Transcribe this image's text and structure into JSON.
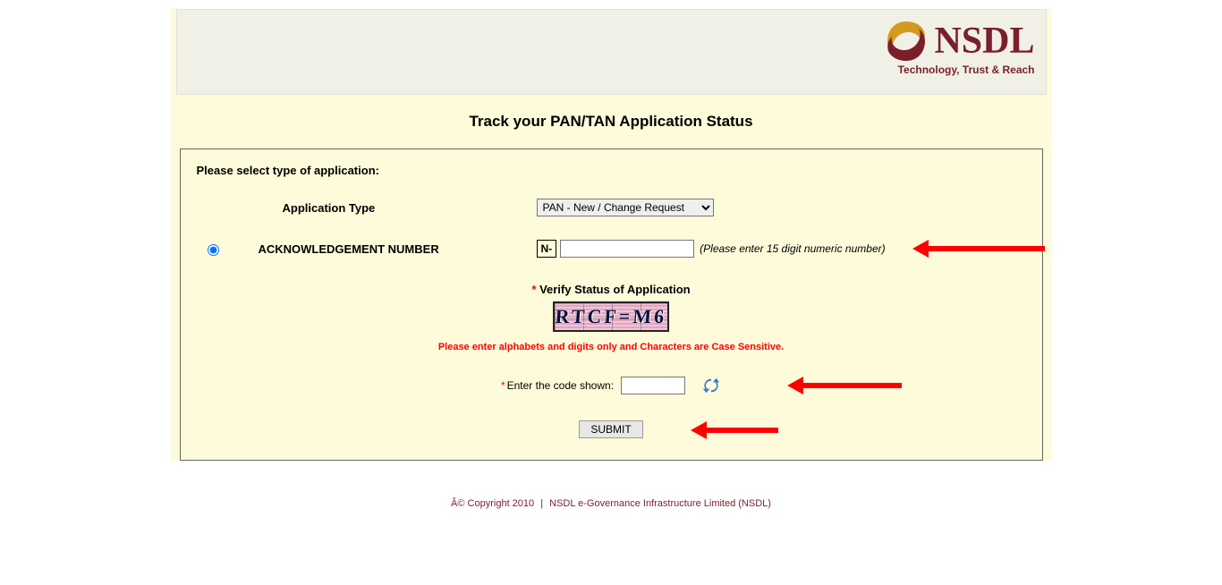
{
  "brand": {
    "name": "NSDL",
    "tagline": "Technology, Trust & Reach"
  },
  "page": {
    "title": "Track your PAN/TAN Application Status"
  },
  "form": {
    "instruction": "Please select type of application:",
    "appTypeLabel": "Application Type",
    "appTypeSelected": "PAN - New / Change Request",
    "ackLabel": "ACKNOWLEDGEMENT NUMBER",
    "ackPrefix": "N-",
    "ackValue": "",
    "ackHint": "(Please enter 15 digit numeric number)"
  },
  "captcha": {
    "title": "Verify Status of Application",
    "imageText": "RTCF=M6",
    "warning": "Please enter alphabets and digits only and Characters are Case Sensitive.",
    "codeLabel": "Enter the code shown:",
    "codeValue": ""
  },
  "actions": {
    "submit": "SUBMIT"
  },
  "footer": {
    "copyright": "Â© Copyright 2010",
    "org": "NSDL e-Governance Infrastructure Limited (NSDL)"
  }
}
